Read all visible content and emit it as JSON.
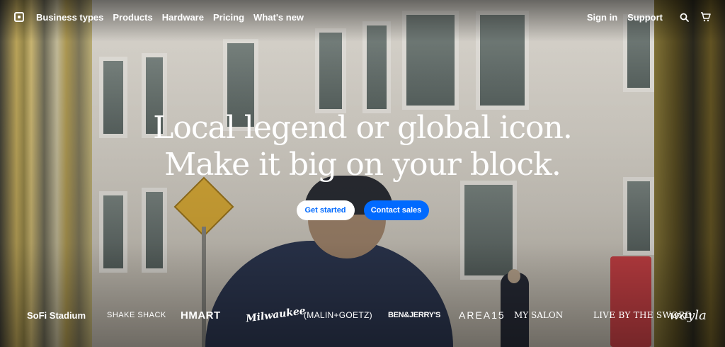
{
  "nav": {
    "logo_icon": "square-logo-icon",
    "left_items": [
      "Business types",
      "Products",
      "Hardware",
      "Pricing",
      "What's new"
    ],
    "right_items": [
      "Sign in",
      "Support"
    ],
    "icons": [
      "search-icon",
      "cart-icon"
    ]
  },
  "hero": {
    "headline_line1": "Local legend or global icon.",
    "headline_line2": "Make it big on your block.",
    "primary_cta": "Get started",
    "secondary_cta": "Contact sales"
  },
  "brands": [
    "SoFi Stadium",
    "SHAKE SHACK",
    "HMART",
    "Milwaukee",
    "(MALIN+GOETZ)",
    "BEN&JERRY'S",
    "AREA15",
    "MY SALON",
    "LIVE BY THE SWORD",
    "wayla"
  ],
  "colors": {
    "primary_blue": "#006aff",
    "text_white": "#ffffff"
  }
}
